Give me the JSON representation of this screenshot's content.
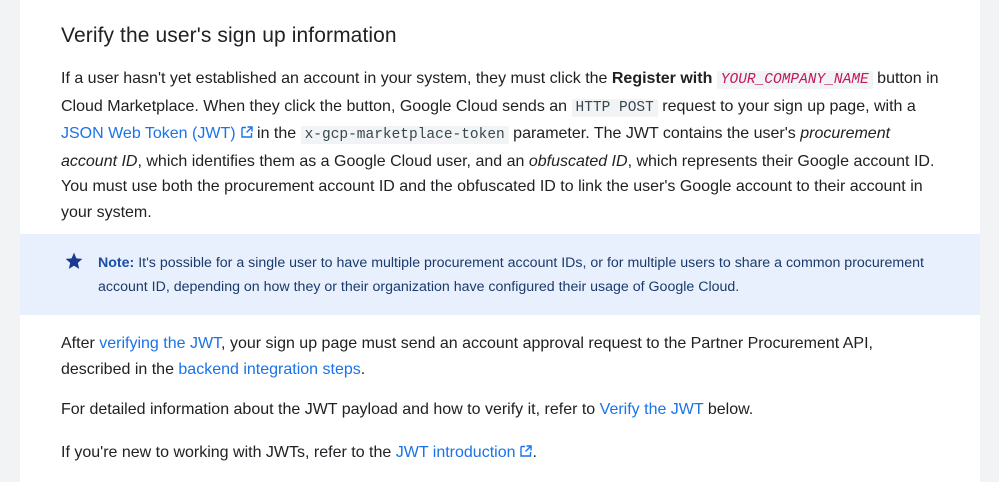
{
  "heading": "Verify the user's sign up information",
  "para1": {
    "t1": "If a user hasn't yet established an account in your system, they must click the ",
    "bold": "Register with",
    "var": "YOUR_COMPANY_NAME",
    "t2": " button in Cloud Marketplace. When they click the button, Google Cloud sends an ",
    "code1": "HTTP POST",
    "t3": " request to your sign up page, with a ",
    "link": "JSON Web Token (JWT)",
    "t4": " in the ",
    "code2": "x-gcp-marketplace-token",
    "t5": " parameter. The JWT contains the user's ",
    "em1": "procurement account ID",
    "t6": ", which identifies them as a Google Cloud user, and an ",
    "em2": "obfuscated ID",
    "t7": ", which represents their Google account ID. You must use both the procurement account ID and the obfuscated ID to link the user's Google account to their account in your system."
  },
  "note": {
    "label": "Note:",
    "text": " It's possible for a single user to have multiple procurement account IDs, or for multiple users to share a common procurement account ID, depending on how they or their organization have configured their usage of Google Cloud."
  },
  "para2": {
    "t1": "After ",
    "link1": "verifying the JWT",
    "t2": ", your sign up page must send an account approval request to the Partner Procurement API, described in the ",
    "link2": "backend integration steps",
    "t3": "."
  },
  "para3": {
    "t1": "For detailed information about the JWT payload and how to verify it, refer to ",
    "link": "Verify the JWT",
    "t2": " below."
  },
  "para4": {
    "t1": "If you're new to working with JWTs, refer to the ",
    "link": "JWT introduction",
    "t2": "."
  },
  "colors": {
    "link": "#1a73e8",
    "note_bg": "#e8f0fe",
    "star": "#1a3a8f"
  }
}
